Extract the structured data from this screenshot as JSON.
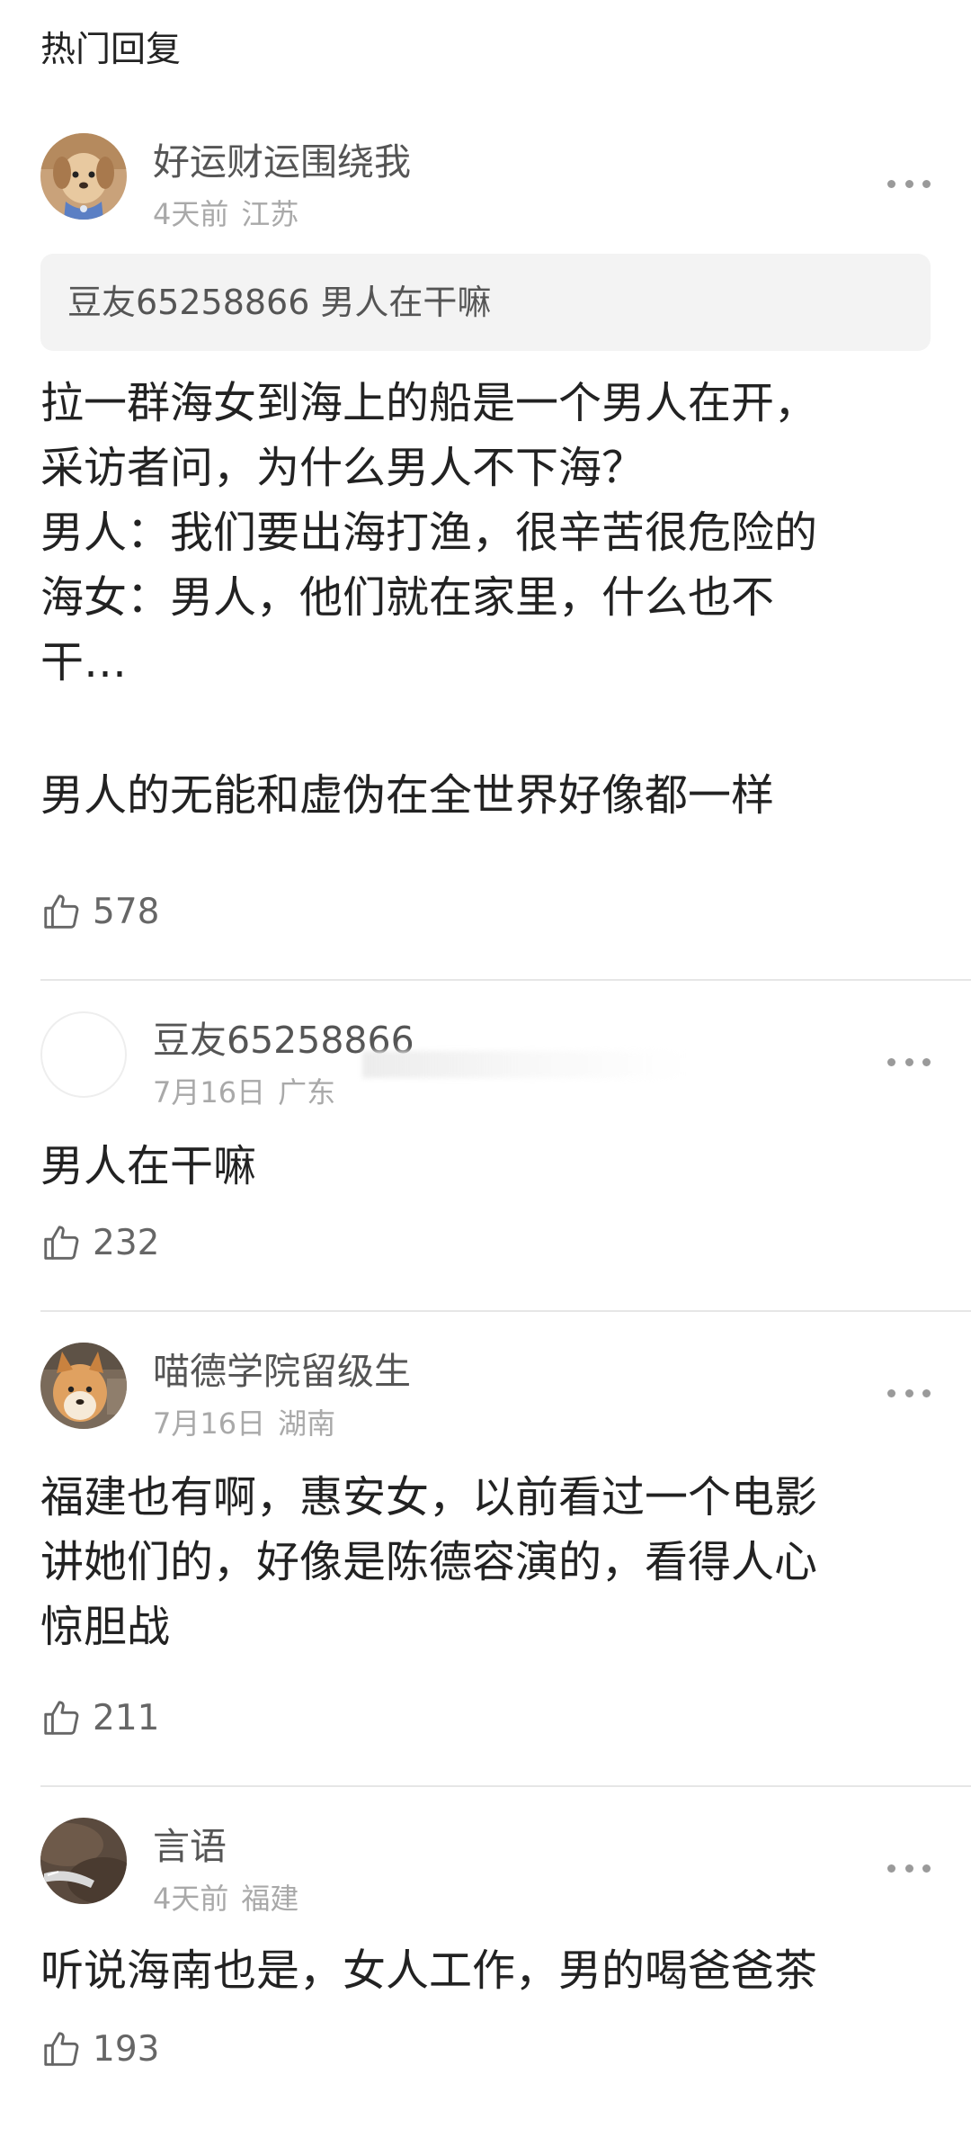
{
  "section_title": "热门回复",
  "comments": [
    {
      "name": "好运财运围绕我",
      "time": "4天前",
      "location": "江苏",
      "quote": {
        "name": "豆友65258866",
        "text": "男人在干嘛"
      },
      "lines": [
        "拉一群海女到海上的船是一个男人在开，",
        "采访者问，为什么男人不下海？",
        "男人：我们要出海打渔，很辛苦很危险的",
        "海女：男人，他们就在家里，什么也不",
        "干…",
        "",
        "男人的无能和虚伪在全世界好像都一样"
      ],
      "likes": "578"
    },
    {
      "name": "豆友65258866",
      "time": "7月16日",
      "location": "广东",
      "lines": [
        "男人在干嘛"
      ],
      "likes": "232"
    },
    {
      "name": "喵德学院留级生",
      "time": "7月16日",
      "location": "湖南",
      "lines": [
        "福建也有啊，惠安女，以前看过一个电影",
        "讲她们的，好像是陈德容演的，看得人心",
        "惊胆战"
      ],
      "likes": "211"
    },
    {
      "name": "言语",
      "time": "4天前",
      "location": "福建",
      "lines": [
        "听说海南也是，女人工作，男的喝爸爸茶"
      ],
      "likes": "193"
    }
  ],
  "icons": {
    "like": "thumbs-up-icon",
    "more": "more-dots-icon"
  }
}
